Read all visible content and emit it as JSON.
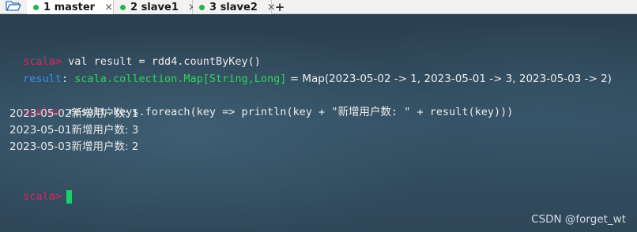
{
  "tabs": [
    {
      "label": "1 master",
      "active": true,
      "status_color": "#1db84a"
    },
    {
      "label": "2 slave1",
      "active": false,
      "status_color": "#1db84a"
    },
    {
      "label": "3 slave2",
      "active": false,
      "status_color": "#1db84a"
    }
  ],
  "tab_close_glyph": "×",
  "add_tab_glyph": "+",
  "terminal": {
    "prompt": "scala>",
    "line1_cmd": " val result = rdd4.countByKey()",
    "line2_name": "result",
    "line2_colon": ": ",
    "line2_type": "scala.collection.Map[String,Long]",
    "line2_rest": " = Map(2023-05-02 -> 1, 2023-05-01 -> 3, 2023-05-03 -> 2)",
    "line4_cmd": " result.keys.foreach(key => println(key + \"新增用户数: \" + result(key)))",
    "output": [
      "2023-05-02新增用户数: 1",
      "2023-05-01新增用户数: 3",
      "2023-05-03新增用户数: 2"
    ],
    "prompt_color": "#e0245e",
    "result_color": "#3a8fe8",
    "type_color": "#2fd35a",
    "cursor_color": "#16d16a"
  },
  "watermark": "CSDN @forget_wt"
}
